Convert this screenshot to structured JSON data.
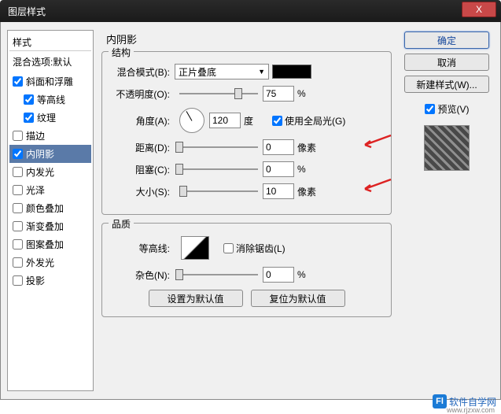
{
  "title": "图层样式",
  "close_x": "X",
  "left": {
    "header": "样式",
    "blend": "混合选项:默认",
    "items": [
      {
        "label": "斜面和浮雕",
        "checked": true
      },
      {
        "label": "等高线",
        "checked": true,
        "indent": true
      },
      {
        "label": "纹理",
        "checked": true,
        "indent": true
      },
      {
        "label": "描边",
        "checked": false
      },
      {
        "label": "内阴影",
        "checked": true,
        "selected": true
      },
      {
        "label": "内发光",
        "checked": false
      },
      {
        "label": "光泽",
        "checked": false
      },
      {
        "label": "颜色叠加",
        "checked": false
      },
      {
        "label": "渐变叠加",
        "checked": false
      },
      {
        "label": "图案叠加",
        "checked": false
      },
      {
        "label": "外发光",
        "checked": false
      },
      {
        "label": "投影",
        "checked": false
      }
    ]
  },
  "center": {
    "panel_title": "内阴影",
    "struct_title": "结构",
    "blend_mode_label": "混合模式(B):",
    "blend_mode_value": "正片叠底",
    "opacity_label": "不透明度(O):",
    "opacity_value": "75",
    "opacity_unit": "%",
    "angle_label": "角度(A):",
    "angle_value": "120",
    "angle_unit": "度",
    "global_light": "使用全局光(G)",
    "distance_label": "距离(D):",
    "distance_value": "0",
    "distance_unit": "像素",
    "choke_label": "阻塞(C):",
    "choke_value": "0",
    "choke_unit": "%",
    "size_label": "大小(S):",
    "size_value": "10",
    "size_unit": "像素",
    "quality_title": "品质",
    "contour_label": "等高线:",
    "antialias": "消除锯齿(L)",
    "noise_label": "杂色(N):",
    "noise_value": "0",
    "noise_unit": "%",
    "default_btn": "设置为默认值",
    "reset_btn": "复位为默认值"
  },
  "right": {
    "ok": "确定",
    "cancel": "取消",
    "new_style": "新建样式(W)...",
    "preview": "预览(V)"
  },
  "watermark": {
    "brand": "软件自学网",
    "url": "www.rjzxw.com"
  }
}
